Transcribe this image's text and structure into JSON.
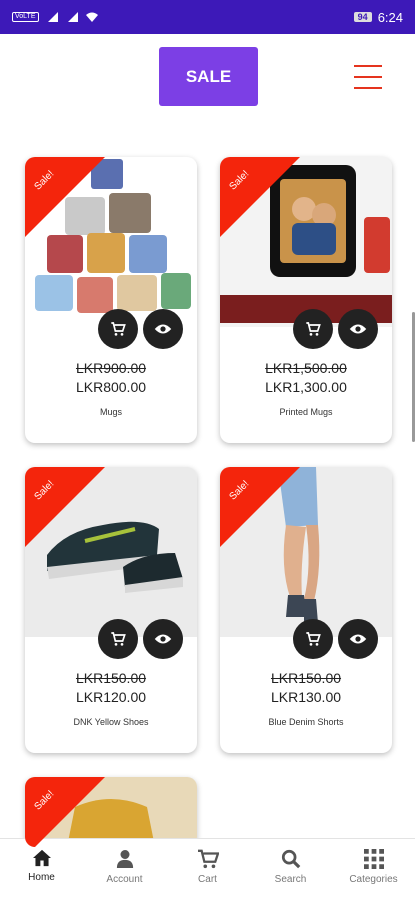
{
  "status": {
    "carrier": "VoLTE",
    "battery": "94",
    "time": "6:24"
  },
  "header": {
    "sale_label": "SALE"
  },
  "products": [
    {
      "name": "Mugs",
      "old_price": "LKR900.00",
      "new_price": "LKR800.00",
      "badge": "Sale!"
    },
    {
      "name": "Printed Mugs",
      "old_price": "LKR1,500.00",
      "new_price": "LKR1,300.00",
      "badge": "Sale!"
    },
    {
      "name": "DNK Yellow Shoes",
      "old_price": "LKR150.00",
      "new_price": "LKR120.00",
      "badge": "Sale!"
    },
    {
      "name": "Blue Denim Shorts",
      "old_price": "LKR150.00",
      "new_price": "LKR130.00",
      "badge": "Sale!"
    },
    {
      "name": "",
      "old_price": "",
      "new_price": "",
      "badge": "Sale!"
    }
  ],
  "nav": [
    {
      "label": "Home",
      "icon": "home-icon",
      "active": true
    },
    {
      "label": "Account",
      "icon": "user-icon",
      "active": false
    },
    {
      "label": "Cart",
      "icon": "cart-icon",
      "active": false
    },
    {
      "label": "Search",
      "icon": "search-icon",
      "active": false
    },
    {
      "label": "Categories",
      "icon": "grid-icon",
      "active": false
    }
  ],
  "colors": {
    "status_bar": "#3d19b8",
    "sale_button": "#7c3fe5",
    "ribbon": "#f4250c",
    "menu": "#e5341e"
  }
}
